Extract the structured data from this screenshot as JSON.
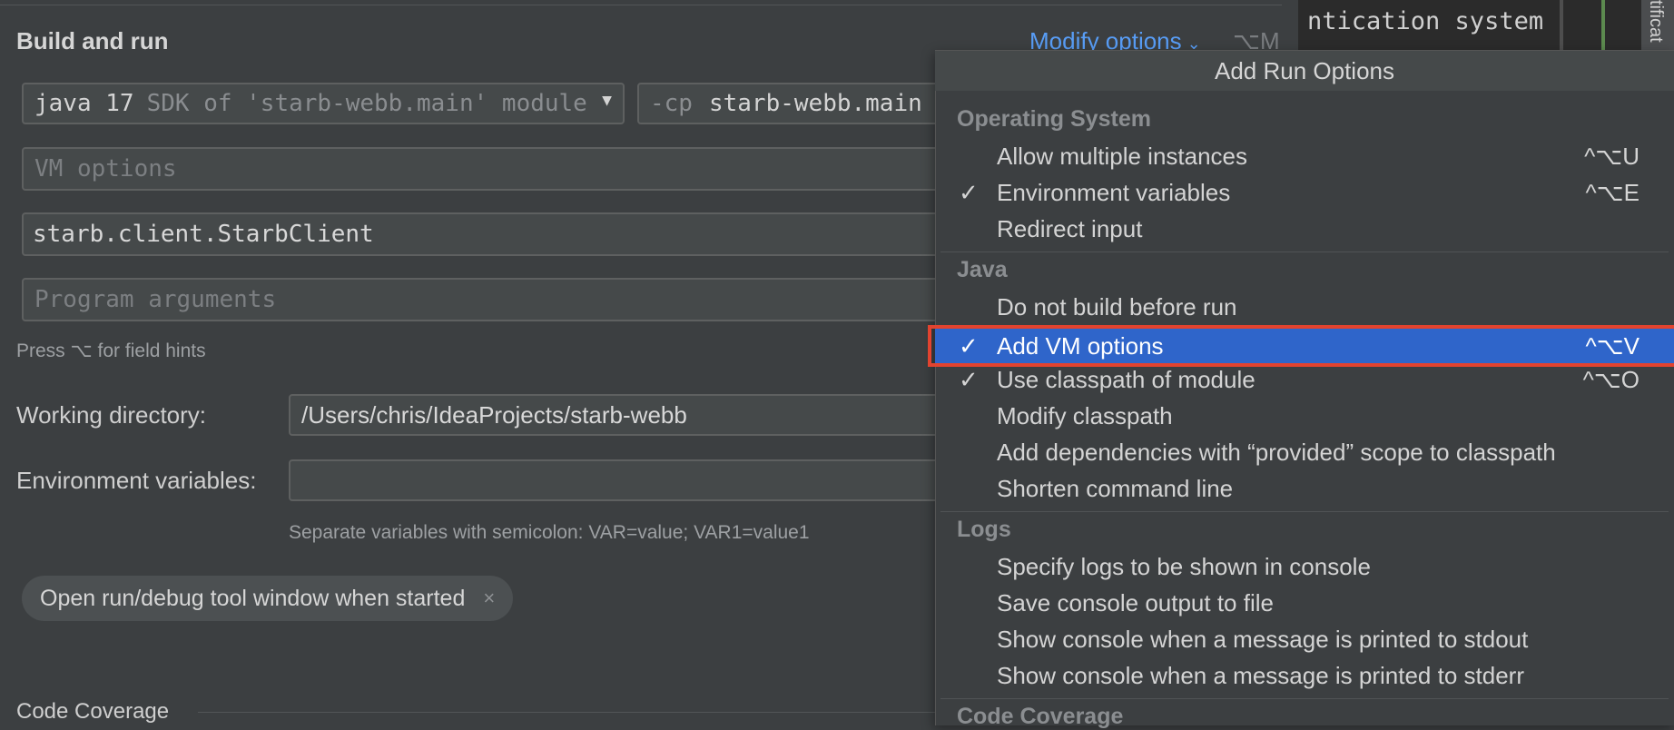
{
  "section": {
    "title": "Build and run",
    "modify_options_label": "Modify options",
    "modify_options_shortcut": "⌥M"
  },
  "jre": {
    "value": "java 17",
    "detail": "SDK of 'starb-webb.main' module"
  },
  "classpath": {
    "prefix": "-cp",
    "value": "starb-webb.main"
  },
  "vm_options": {
    "placeholder": "VM options"
  },
  "main_class": {
    "value": "starb.client.StarbClient"
  },
  "program_args": {
    "placeholder": "Program arguments"
  },
  "field_hint": "Press ⌥ for field hints",
  "working_dir": {
    "label": "Working directory:",
    "value": "/Users/chris/IdeaProjects/starb-webb"
  },
  "env_vars": {
    "label": "Environment variables:",
    "value": "",
    "help": "Separate variables with semicolon: VAR=value; VAR1=value1"
  },
  "chip": {
    "label": "Open run/debug tool window when started",
    "close": "×"
  },
  "code_coverage": {
    "title": "Code Coverage"
  },
  "editor": {
    "text": "ntication system",
    "side_tab": "tificat"
  },
  "popup": {
    "title": "Add Run Options",
    "groups": [
      {
        "name": "Operating System",
        "items": [
          {
            "label": "Allow multiple instances",
            "checked": "",
            "shortcut": "^⌥U"
          },
          {
            "label": "Environment variables",
            "checked": "✓",
            "shortcut": "^⌥E"
          },
          {
            "label": "Redirect input",
            "checked": "",
            "shortcut": ""
          }
        ]
      },
      {
        "name": "Java",
        "items": [
          {
            "label": "Do not build before run",
            "checked": "",
            "shortcut": ""
          },
          {
            "label": "Add VM options",
            "checked": "✓",
            "shortcut": "^⌥V"
          },
          {
            "label": "Use classpath of module",
            "checked": "✓",
            "shortcut": "^⌥O"
          },
          {
            "label": "Modify classpath",
            "checked": "",
            "shortcut": ""
          },
          {
            "label": "Add dependencies with “provided” scope to classpath",
            "checked": "",
            "shortcut": ""
          },
          {
            "label": "Shorten command line",
            "checked": "",
            "shortcut": ""
          }
        ]
      },
      {
        "name": "Logs",
        "items": [
          {
            "label": "Specify logs to be shown in console",
            "checked": "",
            "shortcut": ""
          },
          {
            "label": "Save console output to file",
            "checked": "",
            "shortcut": ""
          },
          {
            "label": "Show console when a message is printed to stdout",
            "checked": "",
            "shortcut": ""
          },
          {
            "label": "Show console when a message is printed to stderr",
            "checked": "",
            "shortcut": ""
          }
        ]
      },
      {
        "name": "Code Coverage",
        "items": []
      }
    ]
  },
  "colors": {
    "accent": "#589df6",
    "selection": "#2f65ca",
    "highlight_border": "#e2432f"
  }
}
